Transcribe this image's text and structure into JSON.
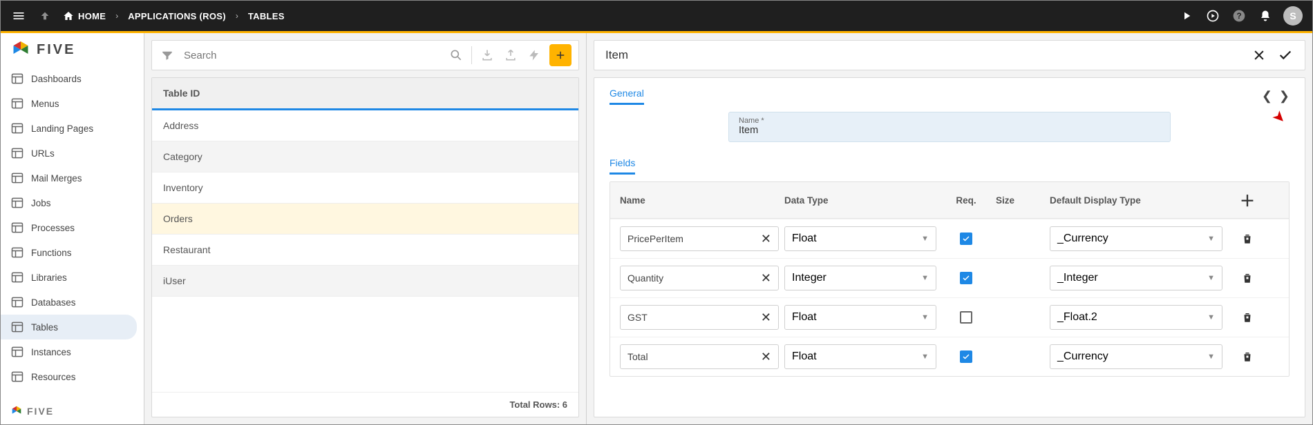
{
  "topbar": {
    "home": "HOME",
    "app": "APPLICATIONS (ROS)",
    "current": "TABLES",
    "avatar_initial": "S"
  },
  "brand": "FIVE",
  "sidebar": {
    "items": [
      {
        "label": "Dashboards",
        "icon": "dash"
      },
      {
        "label": "Menus",
        "icon": "menu"
      },
      {
        "label": "Landing Pages",
        "icon": "landing"
      },
      {
        "label": "URLs",
        "icon": "url"
      },
      {
        "label": "Mail Merges",
        "icon": "mail"
      },
      {
        "label": "Jobs",
        "icon": "job"
      },
      {
        "label": "Processes",
        "icon": "process"
      },
      {
        "label": "Functions",
        "icon": "func"
      },
      {
        "label": "Libraries",
        "icon": "lib"
      },
      {
        "label": "Databases",
        "icon": "db"
      },
      {
        "label": "Tables",
        "icon": "table",
        "active": true
      },
      {
        "label": "Instances",
        "icon": "instance"
      },
      {
        "label": "Resources",
        "icon": "resource"
      }
    ]
  },
  "list": {
    "search_placeholder": "Search",
    "header": "Table ID",
    "rows": [
      {
        "label": "Address"
      },
      {
        "label": "Category",
        "alt": true
      },
      {
        "label": "Inventory"
      },
      {
        "label": "Orders",
        "selected": true
      },
      {
        "label": "Restaurant"
      },
      {
        "label": "iUser",
        "alt": true
      }
    ],
    "footer": "Total Rows: 6"
  },
  "detail": {
    "title": "Item",
    "tab_general": "General",
    "name_field": {
      "label": "Name *",
      "value": "Item"
    },
    "fields_label": "Fields",
    "columns": {
      "name": "Name",
      "datatype": "Data Type",
      "req": "Req.",
      "size": "Size",
      "display": "Default Display Type"
    },
    "rows": [
      {
        "name": "PricePerItem",
        "datatype": "Float",
        "req": true,
        "size": "",
        "display": "_Currency"
      },
      {
        "name": "Quantity",
        "datatype": "Integer",
        "req": true,
        "size": "",
        "display": "_Integer"
      },
      {
        "name": "GST",
        "datatype": "Float",
        "req": false,
        "size": "",
        "display": "_Float.2"
      },
      {
        "name": "Total",
        "datatype": "Float",
        "req": true,
        "size": "",
        "display": "_Currency"
      }
    ]
  }
}
